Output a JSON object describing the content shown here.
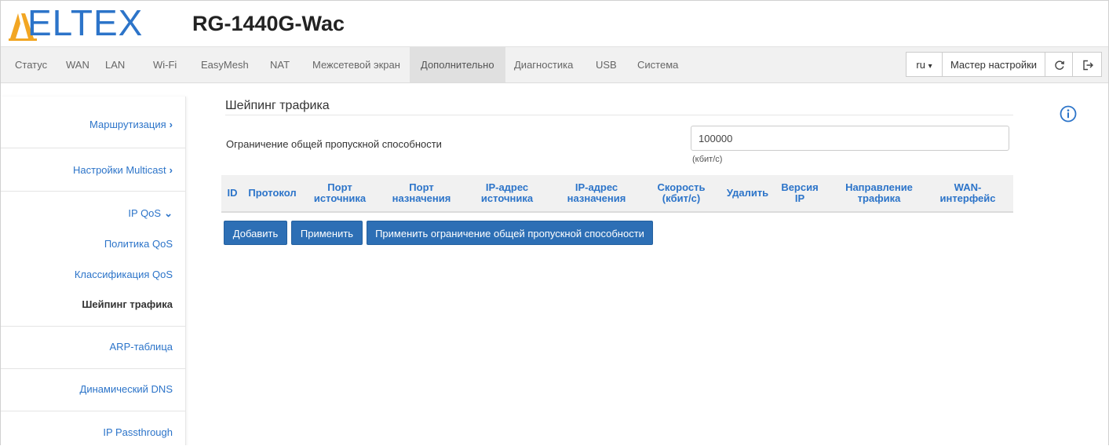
{
  "header": {
    "logo_text": "ELTEX",
    "model": "RG-1440G-Wac",
    "brand_color": "#2c74c9"
  },
  "topnav": {
    "tabs": [
      {
        "label": "Статус",
        "active": false
      },
      {
        "label": "WAN",
        "active": false
      },
      {
        "label": "LAN",
        "active": false
      },
      {
        "label": "Wi-Fi",
        "active": false
      },
      {
        "label": "EasyMesh",
        "active": false
      },
      {
        "label": "NAT",
        "active": false
      },
      {
        "label": "Межсетевой экран",
        "active": false
      },
      {
        "label": "Дополнительно",
        "active": true
      },
      {
        "label": "Диагностика",
        "active": false
      },
      {
        "label": "USB",
        "active": false
      },
      {
        "label": "Система",
        "active": false
      }
    ],
    "language": "ru",
    "language_caret": "▾",
    "wizard_label": "Мастер настройки",
    "refresh_icon": "refresh-icon",
    "logout_icon": "logout-icon"
  },
  "sidebar": {
    "items": [
      {
        "label": "Маршрутизация",
        "chevron": "›"
      },
      {
        "label": "Настройки Multicast",
        "chevron": "›"
      },
      {
        "label": "IP QoS",
        "chevron": "⌄"
      }
    ],
    "subitems": [
      {
        "label": "Политика QoS"
      },
      {
        "label": "Классификация QoS"
      },
      {
        "label": "Шейпинг трафика"
      }
    ],
    "more_items": [
      {
        "label": "ARP-таблица"
      },
      {
        "label": "Динамический DNS"
      },
      {
        "label": "IP Passthrough"
      }
    ]
  },
  "main": {
    "title": "Шейпинг трафика",
    "limit_label": "Ограничение общей пропускной способности",
    "limit_value": "100000",
    "limit_unit": "(кбит/с)",
    "columns": [
      {
        "l1": "ID",
        "l2": ""
      },
      {
        "l1": "Протокол",
        "l2": ""
      },
      {
        "l1": "Порт",
        "l2": "источника"
      },
      {
        "l1": "Порт",
        "l2": "назначения"
      },
      {
        "l1": "IP-адрес",
        "l2": "источника"
      },
      {
        "l1": "IP-адрес",
        "l2": "назначения"
      },
      {
        "l1": "Скорость",
        "l2": "(кбит/с)"
      },
      {
        "l1": "Удалить",
        "l2": ""
      },
      {
        "l1": "Версия",
        "l2": "IP"
      },
      {
        "l1": "Направление",
        "l2": "трафика"
      },
      {
        "l1": "WAN-",
        "l2": "интерфейс"
      }
    ],
    "buttons": {
      "add": "Добавить",
      "apply": "Применить",
      "apply_limit": "Применить ограничение общей пропускной способности"
    },
    "info_icon": "info-icon"
  }
}
